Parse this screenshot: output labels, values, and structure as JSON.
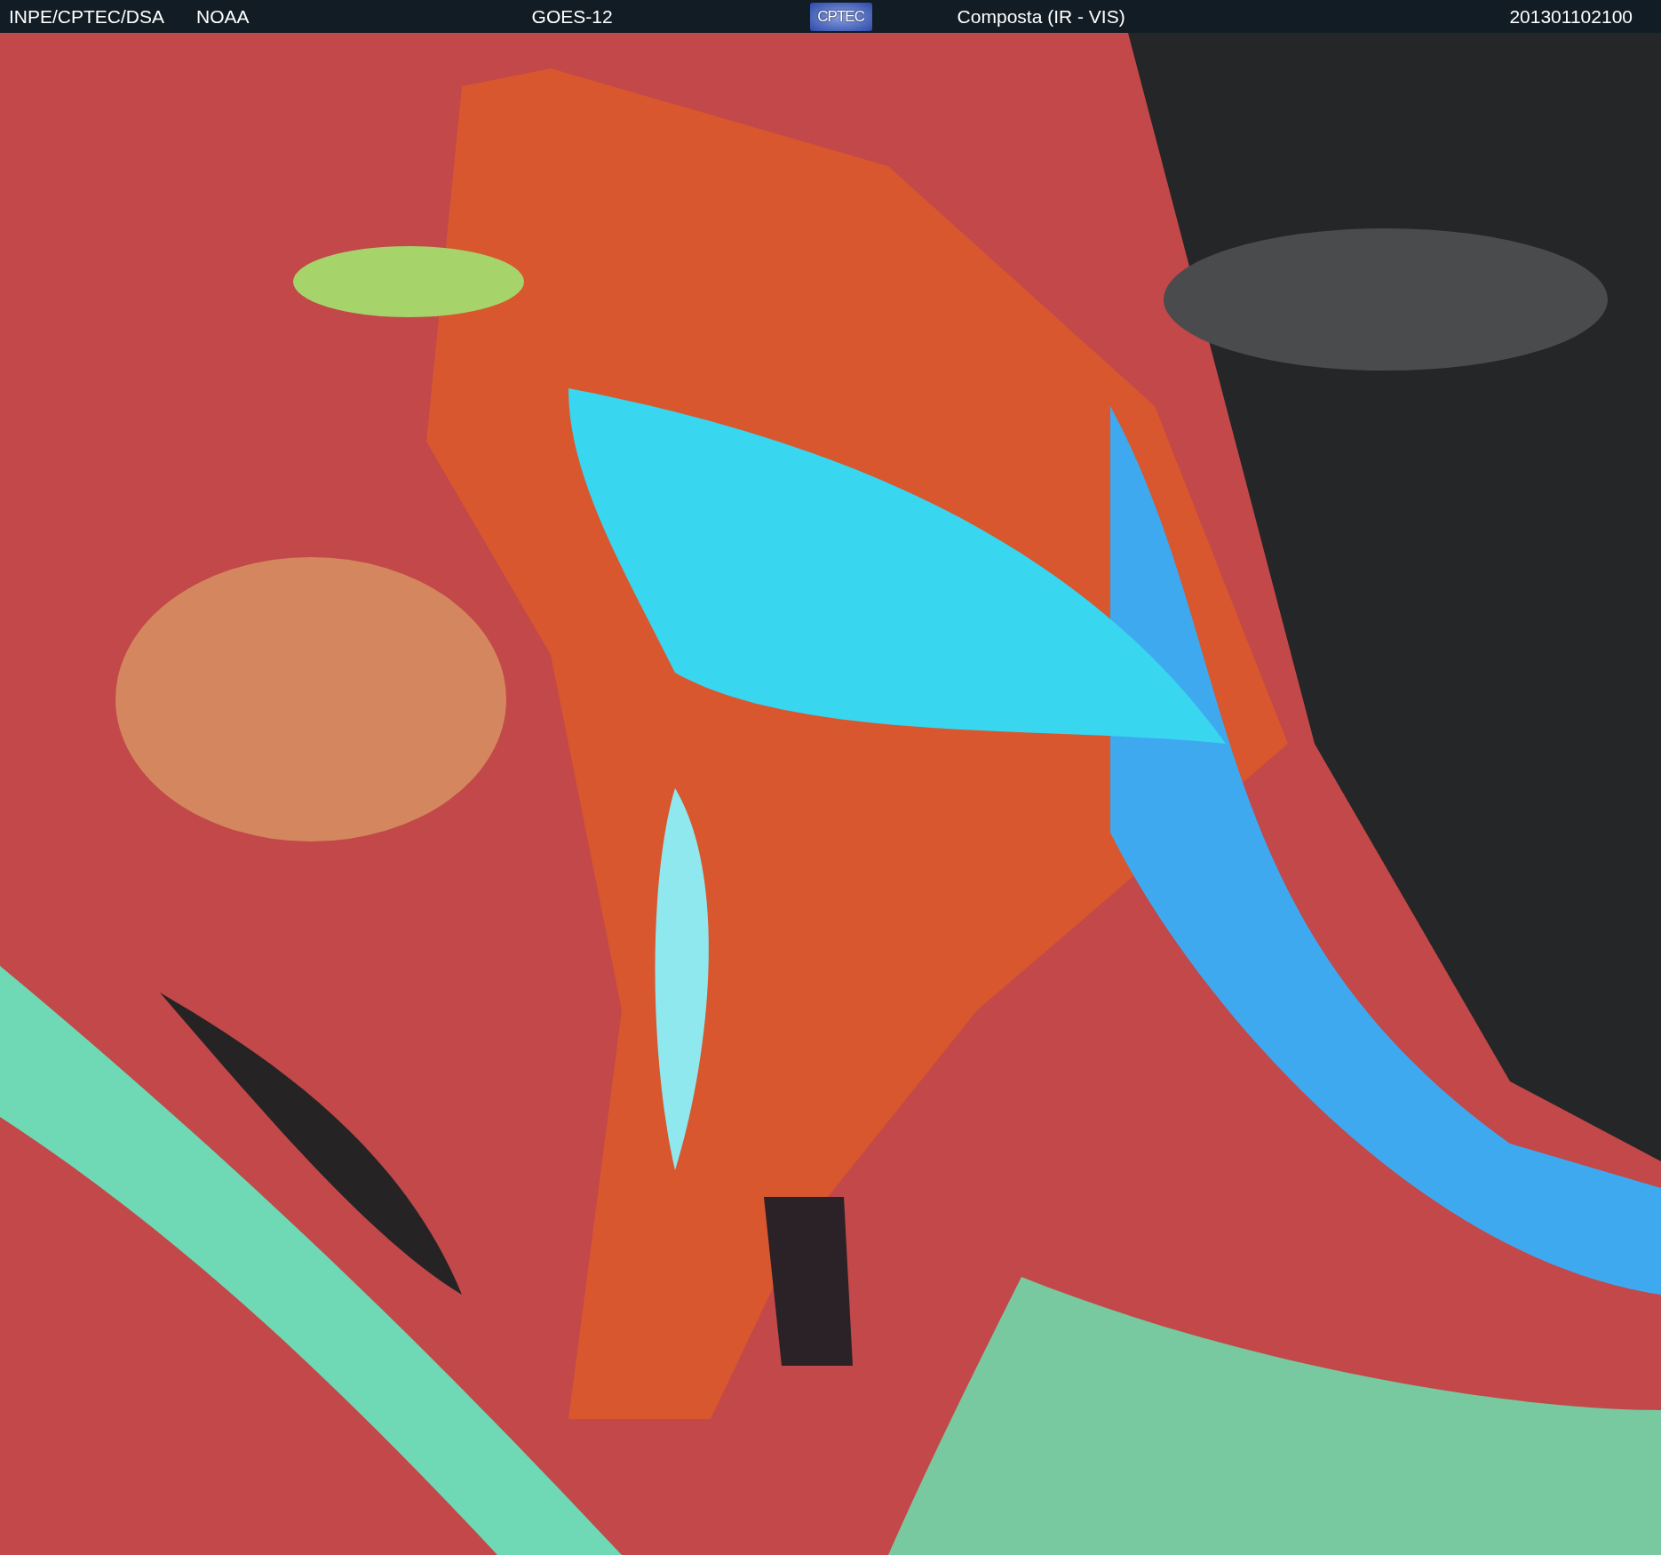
{
  "header": {
    "source": "INPE/CPTEC/DSA",
    "agency": "NOAA",
    "satellite": "GOES-12",
    "logo": "CPTEC",
    "product": "Composta (IR - VIS)",
    "timestamp": "201301102100"
  }
}
